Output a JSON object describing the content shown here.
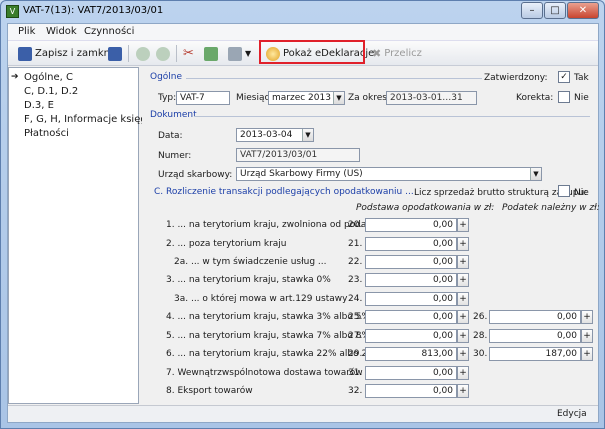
{
  "window": {
    "title": "VAT-7(13): VAT7/2013/03/01"
  },
  "menu": [
    "Plik",
    "Widok",
    "Czynności"
  ],
  "toolbar": {
    "save_close": "Zapisz i zamknij",
    "show_declaration": "Pokaż eDeklaracje",
    "recalc": "Przelicz"
  },
  "tree": [
    "Ogólne, C",
    "C, D.1, D.2",
    "D.3, E",
    "F, G, H, Informacje księg",
    "Płatności"
  ],
  "general": {
    "section": "Ogólne",
    "approved_label": "Zatwierdzony:",
    "approved_value": "Tak",
    "approved_check": "✓",
    "type_label": "Typ:",
    "type_value": "VAT-7",
    "month_label": "Miesiąc:",
    "month_value": "marzec 2013",
    "period_label": "Za okres:",
    "period_value": "2013-03-01…31",
    "correction_label": "Korekta:",
    "correction_value": "Nie"
  },
  "document": {
    "section": "Dokument",
    "date_label": "Data:",
    "date_value": "2013-03-04",
    "number_label": "Numer:",
    "number_value": "VAT7/2013/03/01",
    "office_label": "Urząd skarbowy:",
    "office_value": "Urząd Skarbowy Firmy (US)"
  },
  "section_c": {
    "title": "C. Rozliczenie transakcji podlegających opodatkowaniu ...",
    "gross_label": "Licz sprzedaż brutto strukturą zakupu:",
    "gross_value": "Nie",
    "col_base": "Podstawa opodatkowania w zł:",
    "col_tax": "Podatek należny w zł:",
    "rows": [
      {
        "label": "1. ... na terytorium kraju, zwolniona od podatku:",
        "field": "20.",
        "base": "0,00"
      },
      {
        "label": "2. ... poza terytorium kraju",
        "field": "21.",
        "base": "0,00"
      },
      {
        "label": "2a. ... w tym świadczenie usług ...",
        "field": "22.",
        "base": "0,00"
      },
      {
        "label": "3. ... na terytorium kraju, stawka 0%",
        "field": "23.",
        "base": "0,00"
      },
      {
        "label": "3a. ... o której mowa w art.129 ustawy",
        "field": "24.",
        "base": "0,00"
      },
      {
        "label": "4. ... na terytorium kraju, stawka 3% albo 5%",
        "field": "25.",
        "base": "0,00",
        "tax_field": "26.",
        "tax": "0,00"
      },
      {
        "label": "5. ... na terytorium kraju, stawka 7% albo 8%",
        "field": "27.",
        "base": "0,00",
        "tax_field": "28.",
        "tax": "0,00"
      },
      {
        "label": "6. ... na terytorium kraju, stawka 22% albo 23%",
        "field": "29.",
        "base": "813,00",
        "tax_field": "30.",
        "tax": "187,00"
      },
      {
        "label": "7. Wewnątrzwspólnotowa dostawa towarów",
        "field": "31.",
        "base": "0,00"
      },
      {
        "label": "8. Eksport towarów",
        "field": "32.",
        "base": "0,00"
      }
    ]
  },
  "status": {
    "mode": "Edycja"
  }
}
